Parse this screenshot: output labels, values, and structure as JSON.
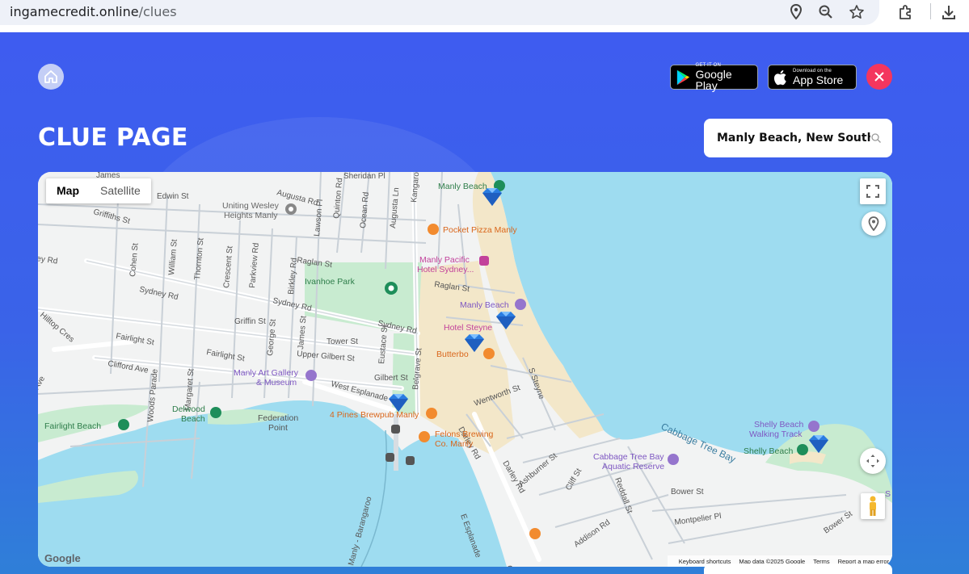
{
  "browser": {
    "domain": "ingamecredit.online",
    "path": "/clues",
    "icons": [
      "location-icon",
      "zoom-icon",
      "star-icon",
      "extensions-icon",
      "download-icon"
    ]
  },
  "header": {
    "google_play": {
      "small": "GET IT ON",
      "big": "Google Play"
    },
    "app_store": {
      "small": "Download on the",
      "big": "App Store"
    }
  },
  "page": {
    "title": "CLUE PAGE"
  },
  "search": {
    "value": "Manly Beach, New South Wales"
  },
  "map": {
    "type_tabs": [
      "Map",
      "Satellite"
    ],
    "active_tab": "Map",
    "footer": {
      "shortcuts": "Keyboard shortcuts",
      "mapdata": "Map data ©2025 Google",
      "terms": "Terms",
      "report": "Report a map error"
    },
    "logo": "Google",
    "street_labels": [
      "James St",
      "Edwin St",
      "Augusta Rd",
      "Sheridan Pl",
      "Quinton Rd",
      "Kangaroo St",
      "Griffiths St",
      "Lawson Pl",
      "Ocean Rd",
      "Augusta Ln",
      "Cohen St",
      "William St",
      "Thornton St",
      "Crescent St",
      "Parkview Rd",
      "Birkley Rd",
      "Raglan St",
      "Sydney Rd",
      "Hilltop Cres",
      "Fairlight St",
      "Griffin St",
      "George St",
      "James St",
      "Tower St",
      "Eustace St",
      "Upper Gilbert St",
      "Belgrave St",
      "Clifford Ave",
      "Woods Parade",
      "Margaret St",
      "Gilbert St",
      "West Esplanade",
      "Darley Rd",
      "Wentworth St",
      "S Steyne",
      "Ashburner St",
      "Cliff St",
      "Reddall St",
      "Bower St",
      "Montpelier Pl",
      "Addison Rd",
      "E Esplanade",
      "Manly - Barangaroo",
      "Cabbage Tree Bay",
      "Ave"
    ],
    "place_labels": {
      "uniting": [
        "Uniting Wesley",
        "Heights Manly"
      ],
      "ivanhoe": "Ivanhoe Park",
      "pizza": "Pocket Pizza Manly",
      "pacific": [
        "Manly Pacific",
        "Hotel Sydney..."
      ],
      "manly_beach_top": "Manly Beach",
      "manly_beach_mid": "Manly Beach",
      "steyne": "Hotel Steyne",
      "butter": "Butterbo",
      "gallery": [
        "Manly Art Gallery",
        "& Museum"
      ],
      "delwood": [
        "Delwood",
        "Beach"
      ],
      "federation": [
        "Federation",
        "Point"
      ],
      "brewpub": "4 Pines Brewpub Manly",
      "felons": [
        "Felons Brewing",
        "Co. Manly"
      ],
      "fairlight_beach": "Fairlight Beach",
      "cabbage_reserve": [
        "Cabbage Tree Bay",
        "Aquatic Reserve"
      ],
      "shelly_track": [
        "Shelly Beach",
        "Walking Track"
      ],
      "shelly_beach": "Shelly Beach"
    },
    "markers": [
      "diamond-marker",
      "diamond-marker",
      "diamond-marker",
      "diamond-marker",
      "diamond-marker"
    ]
  },
  "colors": {
    "page_bg": "#3e5cf0",
    "close": "#f4365e",
    "water": "#9edcf0",
    "park": "#c8ebd0",
    "sand": "#f3e7c9"
  }
}
